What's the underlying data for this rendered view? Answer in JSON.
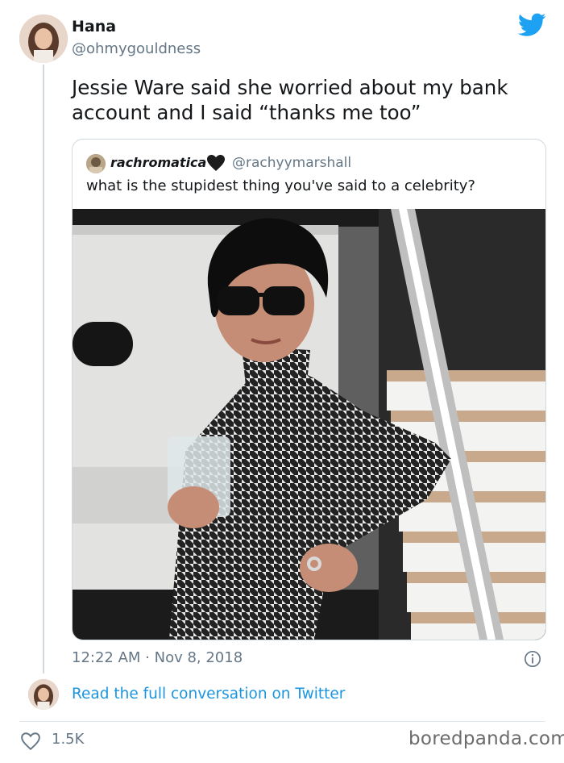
{
  "tweet": {
    "display_name": "Hana",
    "handle": "@ohmygouldness",
    "text": "Jessie Ware said she worried about my bank account and I said “thanks me too”",
    "timestamp": "12:22 AM · Nov 8, 2018",
    "like_count": "1.5K",
    "read_link": "Read the full conversation on Twitter",
    "brand_color": "#1da1f2"
  },
  "quote": {
    "name": "rachromatica",
    "name_emoji_icon": "black-heart-icon",
    "handle": "@rachyymarshall",
    "text": "what is the stupidest thing you've said to a celebrity?"
  },
  "icons": {
    "logo": "twitter-bird-icon",
    "info": "info-icon",
    "like": "heart-outline-icon"
  },
  "watermark": "boredpanda.com"
}
